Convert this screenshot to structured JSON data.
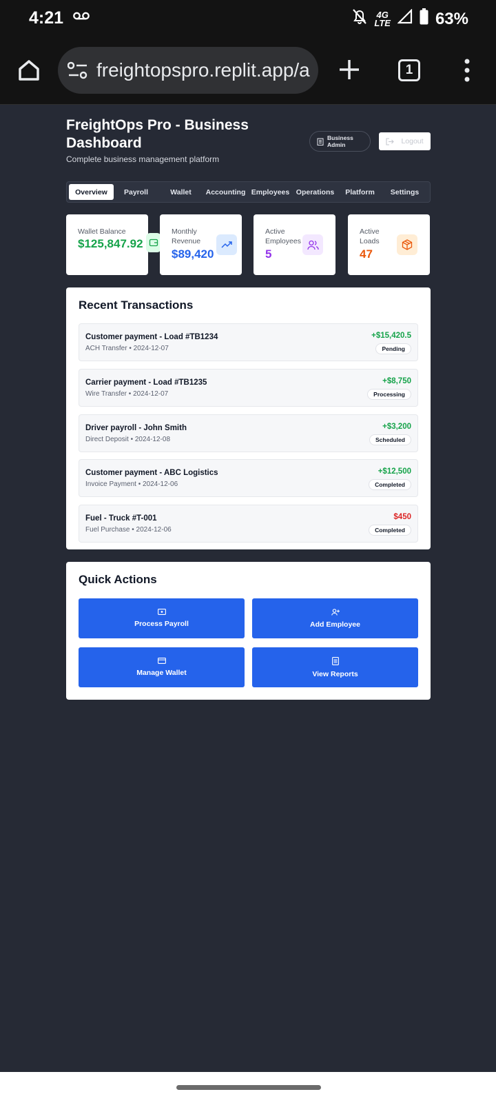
{
  "status_bar": {
    "time": "4:21",
    "battery": "63%",
    "network": "4G",
    "network_sub": "LTE"
  },
  "browser": {
    "url": "freightopspro.replit.app/a",
    "tab_count": "1"
  },
  "header": {
    "title": "FreightOps Pro - Business Dashboard",
    "subtitle": "Complete business management platform",
    "role_badge": "Business Admin",
    "logout_label": "Logout"
  },
  "tabs": [
    {
      "label": "Overview",
      "active": true
    },
    {
      "label": "Payroll"
    },
    {
      "label": "Wallet"
    },
    {
      "label": "Accounting"
    },
    {
      "label": "Employees"
    },
    {
      "label": "Operations"
    },
    {
      "label": "Platform"
    },
    {
      "label": "Settings"
    }
  ],
  "stats": [
    {
      "label": "Wallet Balance",
      "value": "$125,847.92",
      "color": "#16a34a",
      "icon": "wallet-icon"
    },
    {
      "label": "Monthly Revenue",
      "value": "$89,420",
      "color": "#2563eb",
      "icon": "trending-up-icon"
    },
    {
      "label": "Active Employees",
      "value": "5",
      "color": "#9333ea",
      "icon": "users-icon"
    },
    {
      "label": "Active Loads",
      "value": "47",
      "color": "#ea580c",
      "icon": "package-icon"
    }
  ],
  "recent_transactions": {
    "title": "Recent Transactions",
    "items": [
      {
        "description": "Customer payment - Load #TB1234",
        "meta": "ACH Transfer • 2024-12-07",
        "amount": "+$15,420.5",
        "status": "Pending",
        "amount_color": "#16a34a"
      },
      {
        "description": "Carrier payment - Load #TB1235",
        "meta": "Wire Transfer • 2024-12-07",
        "amount": "+$8,750",
        "status": "Processing",
        "amount_color": "#16a34a"
      },
      {
        "description": "Driver payroll - John Smith",
        "meta": "Direct Deposit • 2024-12-08",
        "amount": "+$3,200",
        "status": "Scheduled",
        "amount_color": "#16a34a"
      },
      {
        "description": "Customer payment - ABC Logistics",
        "meta": "Invoice Payment • 2024-12-06",
        "amount": "+$12,500",
        "status": "Completed",
        "amount_color": "#16a34a"
      },
      {
        "description": "Fuel - Truck #T-001",
        "meta": "Fuel Purchase • 2024-12-06",
        "amount": "$450",
        "status": "Completed",
        "amount_color": "#dc2626"
      }
    ]
  },
  "quick_actions": {
    "title": "Quick Actions",
    "buttons": [
      {
        "label": "Process Payroll",
        "icon": "banknote-icon"
      },
      {
        "label": "Add Employee",
        "icon": "user-plus-icon"
      },
      {
        "label": "Manage Wallet",
        "icon": "credit-card-icon"
      },
      {
        "label": "View Reports",
        "icon": "file-text-icon"
      }
    ]
  },
  "colors": {
    "page_bg": "#262a35",
    "primary": "#2563eb",
    "positive": "#16a34a",
    "negative": "#dc2626"
  }
}
